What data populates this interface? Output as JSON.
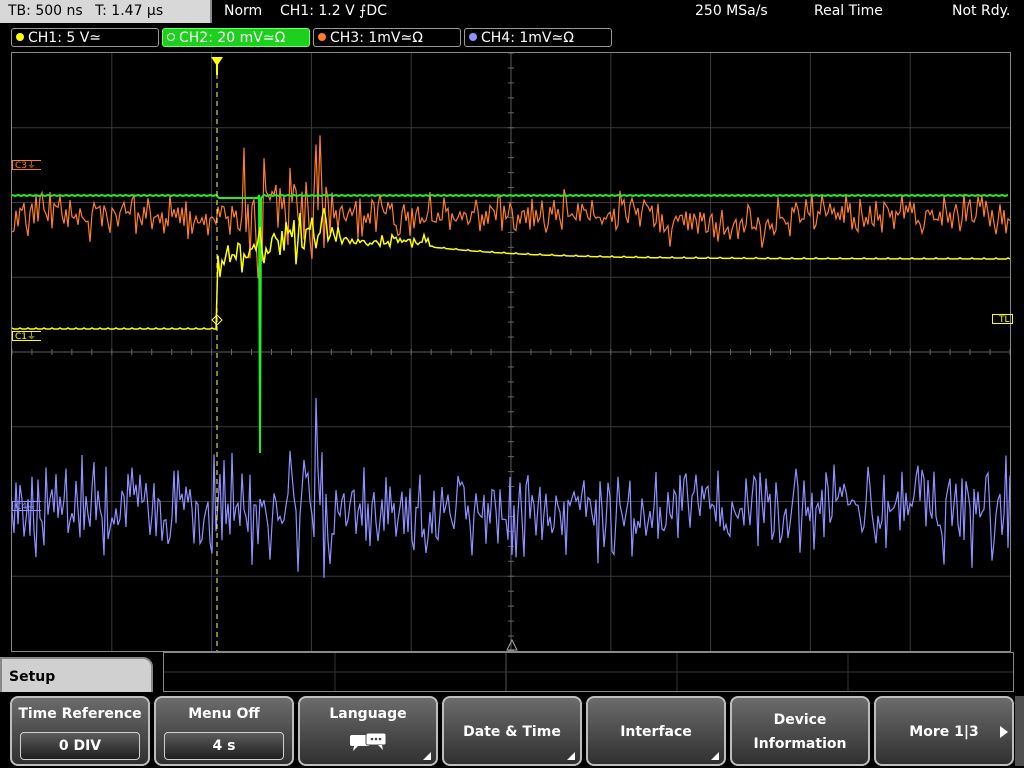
{
  "header": {
    "timebase": "TB: 500 ns",
    "trigger_pos": "T: 1.47 µs",
    "mode": "Norm",
    "trigger_info": "CH1: 1.2 V ⨍DC",
    "sample_rate": "250 MSa/s",
    "acq_mode": "Real Time",
    "status": "Not Rdy."
  },
  "channels": [
    {
      "label": "CH1: 5 V≃",
      "color": "#ffff00",
      "active": false
    },
    {
      "label": "CH2: 20 mV≃Ω",
      "color": "#22ee22",
      "active": true
    },
    {
      "label": "CH3: 1mV≃Ω",
      "color": "#ff7f27",
      "active": false
    },
    {
      "label": "CH4: 1mV≃Ω",
      "color": "#9090ff",
      "active": false
    }
  ],
  "markers": {
    "c3": "C3⏚",
    "c1": "C1⏚",
    "tl": "TL",
    "c4": "C4⏚"
  },
  "traces": {
    "ch1_color": "#ffff00",
    "ch2_color": "#22ee22",
    "ch3_color": "#ff7f27",
    "ch4_color": "#9090ff"
  },
  "menu": {
    "tab": "Setup",
    "softkeys": [
      {
        "id": "time-reference",
        "label": "Time Reference",
        "value": "0 DIV"
      },
      {
        "id": "menu-off",
        "label": "Menu Off",
        "value": "4 s"
      },
      {
        "id": "language",
        "label": "Language",
        "icon": "speech-bubbles-icon"
      },
      {
        "id": "date-time",
        "label": "Date & Time"
      },
      {
        "id": "interface",
        "label": "Interface"
      },
      {
        "id": "device-info",
        "label": "Device",
        "label2": "Information"
      },
      {
        "id": "more",
        "label": "More 1|3"
      }
    ]
  }
}
